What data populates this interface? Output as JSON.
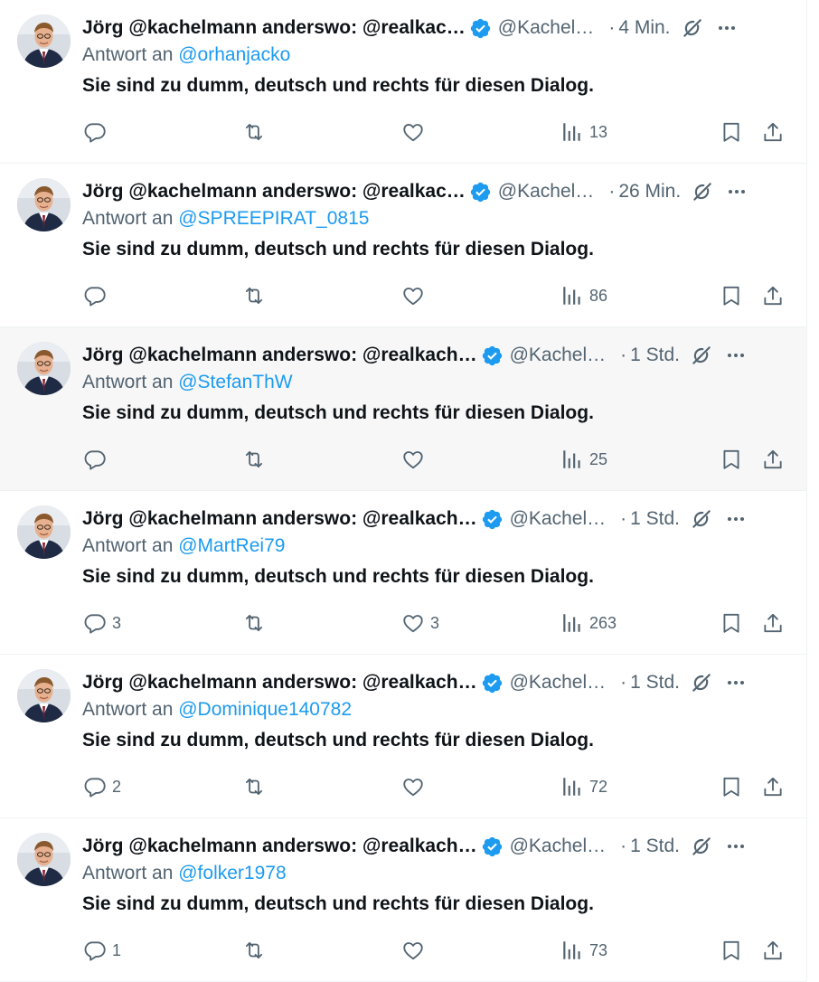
{
  "colors": {
    "accent": "#1d9bf0",
    "secondary_text": "#536471",
    "primary_text": "#0f1419"
  },
  "tweets": [
    {
      "display_name": "Jörg @kachelmann anderswo: @realkac…",
      "handle": "@Kachel…",
      "dot": "·",
      "time": "4 Min.",
      "reply_prefix": "Antwort an",
      "reply_to": "@orhanjacko",
      "text": "Sie sind zu dumm, deutsch und rechts für diesen Dialog.",
      "replies": "",
      "retweets": "",
      "likes": "",
      "views": "13"
    },
    {
      "display_name": "Jörg @kachelmann anderswo: @realkac…",
      "handle": "@Kachel…",
      "dot": "·",
      "time": "26 Min.",
      "reply_prefix": "Antwort an",
      "reply_to": "@SPREEPIRAT_0815",
      "text": "Sie sind zu dumm, deutsch und rechts für diesen Dialog.",
      "replies": "",
      "retweets": "",
      "likes": "",
      "views": "86"
    },
    {
      "display_name": "Jörg @kachelmann anderswo: @realkach…",
      "handle": "@Kachel…",
      "dot": "·",
      "time": "1 Std.",
      "reply_prefix": "Antwort an",
      "reply_to": "@StefanThW",
      "text": "Sie sind zu dumm, deutsch und rechts für diesen Dialog.",
      "replies": "",
      "retweets": "",
      "likes": "",
      "views": "25"
    },
    {
      "display_name": "Jörg @kachelmann anderswo: @realkach…",
      "handle": "@Kachel…",
      "dot": "·",
      "time": "1 Std.",
      "reply_prefix": "Antwort an",
      "reply_to": "@MartRei79",
      "text": "Sie sind zu dumm, deutsch und rechts für diesen Dialog.",
      "replies": "3",
      "retweets": "",
      "likes": "3",
      "views": "263"
    },
    {
      "display_name": "Jörg @kachelmann anderswo: @realkach…",
      "handle": "@Kachel…",
      "dot": "·",
      "time": "1 Std.",
      "reply_prefix": "Antwort an",
      "reply_to": "@Dominique140782",
      "text": "Sie sind zu dumm, deutsch und rechts für diesen Dialog.",
      "replies": "2",
      "retweets": "",
      "likes": "",
      "views": "72"
    },
    {
      "display_name": "Jörg @kachelmann anderswo: @realkach…",
      "handle": "@Kachel…",
      "dot": "·",
      "time": "1 Std.",
      "reply_prefix": "Antwort an",
      "reply_to": "@folker1978",
      "text": "Sie sind zu dumm, deutsch und rechts für diesen Dialog.",
      "replies": "1",
      "retweets": "",
      "likes": "",
      "views": "73"
    }
  ],
  "icons": {
    "reply": "reply-icon",
    "retweet": "retweet-icon",
    "like": "like-icon",
    "views": "views-icon",
    "bookmark": "bookmark-icon",
    "share": "share-icon",
    "verified": "verified-badge-icon",
    "grok": "grok-icon",
    "more": "more-icon"
  }
}
